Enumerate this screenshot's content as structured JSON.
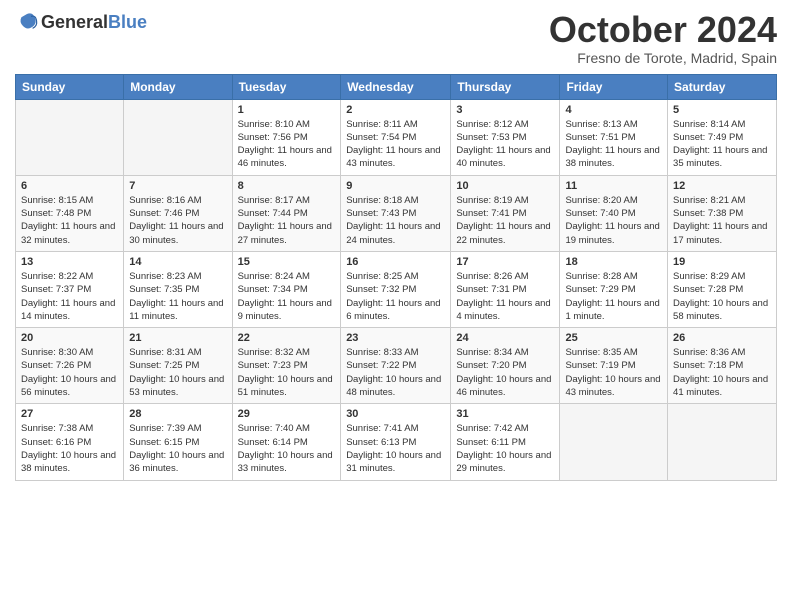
{
  "header": {
    "logo": {
      "general": "General",
      "blue": "Blue"
    },
    "title": "October 2024",
    "location": "Fresno de Torote, Madrid, Spain"
  },
  "weekdays": [
    "Sunday",
    "Monday",
    "Tuesday",
    "Wednesday",
    "Thursday",
    "Friday",
    "Saturday"
  ],
  "weeks": [
    [
      {
        "day": "",
        "empty": true
      },
      {
        "day": "",
        "empty": true
      },
      {
        "day": "1",
        "sunrise": "Sunrise: 8:10 AM",
        "sunset": "Sunset: 7:56 PM",
        "daylight": "Daylight: 11 hours and 46 minutes."
      },
      {
        "day": "2",
        "sunrise": "Sunrise: 8:11 AM",
        "sunset": "Sunset: 7:54 PM",
        "daylight": "Daylight: 11 hours and 43 minutes."
      },
      {
        "day": "3",
        "sunrise": "Sunrise: 8:12 AM",
        "sunset": "Sunset: 7:53 PM",
        "daylight": "Daylight: 11 hours and 40 minutes."
      },
      {
        "day": "4",
        "sunrise": "Sunrise: 8:13 AM",
        "sunset": "Sunset: 7:51 PM",
        "daylight": "Daylight: 11 hours and 38 minutes."
      },
      {
        "day": "5",
        "sunrise": "Sunrise: 8:14 AM",
        "sunset": "Sunset: 7:49 PM",
        "daylight": "Daylight: 11 hours and 35 minutes."
      }
    ],
    [
      {
        "day": "6",
        "sunrise": "Sunrise: 8:15 AM",
        "sunset": "Sunset: 7:48 PM",
        "daylight": "Daylight: 11 hours and 32 minutes."
      },
      {
        "day": "7",
        "sunrise": "Sunrise: 8:16 AM",
        "sunset": "Sunset: 7:46 PM",
        "daylight": "Daylight: 11 hours and 30 minutes."
      },
      {
        "day": "8",
        "sunrise": "Sunrise: 8:17 AM",
        "sunset": "Sunset: 7:44 PM",
        "daylight": "Daylight: 11 hours and 27 minutes."
      },
      {
        "day": "9",
        "sunrise": "Sunrise: 8:18 AM",
        "sunset": "Sunset: 7:43 PM",
        "daylight": "Daylight: 11 hours and 24 minutes."
      },
      {
        "day": "10",
        "sunrise": "Sunrise: 8:19 AM",
        "sunset": "Sunset: 7:41 PM",
        "daylight": "Daylight: 11 hours and 22 minutes."
      },
      {
        "day": "11",
        "sunrise": "Sunrise: 8:20 AM",
        "sunset": "Sunset: 7:40 PM",
        "daylight": "Daylight: 11 hours and 19 minutes."
      },
      {
        "day": "12",
        "sunrise": "Sunrise: 8:21 AM",
        "sunset": "Sunset: 7:38 PM",
        "daylight": "Daylight: 11 hours and 17 minutes."
      }
    ],
    [
      {
        "day": "13",
        "sunrise": "Sunrise: 8:22 AM",
        "sunset": "Sunset: 7:37 PM",
        "daylight": "Daylight: 11 hours and 14 minutes."
      },
      {
        "day": "14",
        "sunrise": "Sunrise: 8:23 AM",
        "sunset": "Sunset: 7:35 PM",
        "daylight": "Daylight: 11 hours and 11 minutes."
      },
      {
        "day": "15",
        "sunrise": "Sunrise: 8:24 AM",
        "sunset": "Sunset: 7:34 PM",
        "daylight": "Daylight: 11 hours and 9 minutes."
      },
      {
        "day": "16",
        "sunrise": "Sunrise: 8:25 AM",
        "sunset": "Sunset: 7:32 PM",
        "daylight": "Daylight: 11 hours and 6 minutes."
      },
      {
        "day": "17",
        "sunrise": "Sunrise: 8:26 AM",
        "sunset": "Sunset: 7:31 PM",
        "daylight": "Daylight: 11 hours and 4 minutes."
      },
      {
        "day": "18",
        "sunrise": "Sunrise: 8:28 AM",
        "sunset": "Sunset: 7:29 PM",
        "daylight": "Daylight: 11 hours and 1 minute."
      },
      {
        "day": "19",
        "sunrise": "Sunrise: 8:29 AM",
        "sunset": "Sunset: 7:28 PM",
        "daylight": "Daylight: 10 hours and 58 minutes."
      }
    ],
    [
      {
        "day": "20",
        "sunrise": "Sunrise: 8:30 AM",
        "sunset": "Sunset: 7:26 PM",
        "daylight": "Daylight: 10 hours and 56 minutes."
      },
      {
        "day": "21",
        "sunrise": "Sunrise: 8:31 AM",
        "sunset": "Sunset: 7:25 PM",
        "daylight": "Daylight: 10 hours and 53 minutes."
      },
      {
        "day": "22",
        "sunrise": "Sunrise: 8:32 AM",
        "sunset": "Sunset: 7:23 PM",
        "daylight": "Daylight: 10 hours and 51 minutes."
      },
      {
        "day": "23",
        "sunrise": "Sunrise: 8:33 AM",
        "sunset": "Sunset: 7:22 PM",
        "daylight": "Daylight: 10 hours and 48 minutes."
      },
      {
        "day": "24",
        "sunrise": "Sunrise: 8:34 AM",
        "sunset": "Sunset: 7:20 PM",
        "daylight": "Daylight: 10 hours and 46 minutes."
      },
      {
        "day": "25",
        "sunrise": "Sunrise: 8:35 AM",
        "sunset": "Sunset: 7:19 PM",
        "daylight": "Daylight: 10 hours and 43 minutes."
      },
      {
        "day": "26",
        "sunrise": "Sunrise: 8:36 AM",
        "sunset": "Sunset: 7:18 PM",
        "daylight": "Daylight: 10 hours and 41 minutes."
      }
    ],
    [
      {
        "day": "27",
        "sunrise": "Sunrise: 7:38 AM",
        "sunset": "Sunset: 6:16 PM",
        "daylight": "Daylight: 10 hours and 38 minutes."
      },
      {
        "day": "28",
        "sunrise": "Sunrise: 7:39 AM",
        "sunset": "Sunset: 6:15 PM",
        "daylight": "Daylight: 10 hours and 36 minutes."
      },
      {
        "day": "29",
        "sunrise": "Sunrise: 7:40 AM",
        "sunset": "Sunset: 6:14 PM",
        "daylight": "Daylight: 10 hours and 33 minutes."
      },
      {
        "day": "30",
        "sunrise": "Sunrise: 7:41 AM",
        "sunset": "Sunset: 6:13 PM",
        "daylight": "Daylight: 10 hours and 31 minutes."
      },
      {
        "day": "31",
        "sunrise": "Sunrise: 7:42 AM",
        "sunset": "Sunset: 6:11 PM",
        "daylight": "Daylight: 10 hours and 29 minutes."
      },
      {
        "day": "",
        "empty": true
      },
      {
        "day": "",
        "empty": true
      }
    ]
  ]
}
